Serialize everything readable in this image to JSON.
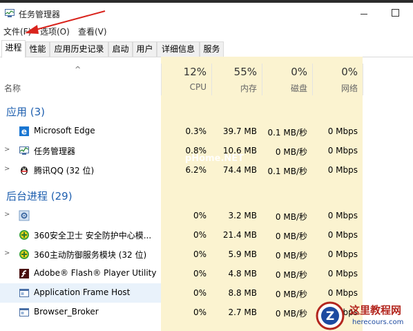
{
  "window": {
    "title": "任务管理器"
  },
  "menu": [
    {
      "label": "文件(F)"
    },
    {
      "label": "选项(O)"
    },
    {
      "label": "查看(V)"
    }
  ],
  "tabs": [
    {
      "label": "进程",
      "active": true
    },
    {
      "label": "性能"
    },
    {
      "label": "应用历史记录"
    },
    {
      "label": "启动"
    },
    {
      "label": "用户"
    },
    {
      "label": "详细信息"
    },
    {
      "label": "服务"
    }
  ],
  "columns": {
    "name_label": "名称",
    "cpu": {
      "percent": "12%",
      "label": "CPU"
    },
    "memory": {
      "percent": "55%",
      "label": "内存"
    },
    "disk": {
      "percent": "0%",
      "label": "磁盘"
    },
    "network": {
      "percent": "0%",
      "label": "网络"
    }
  },
  "groups": [
    {
      "title": "应用 (3)",
      "rows": [
        {
          "name": "Microsoft Edge",
          "icon": "edge-icon",
          "cpu": "0.3%",
          "memory": "39.7 MB",
          "disk": "0.1 MB/秒",
          "network": "0 Mbps",
          "expandable": false
        },
        {
          "name": "任务管理器",
          "icon": "task-manager-icon",
          "cpu": "0.8%",
          "memory": "10.6 MB",
          "disk": "0 MB/秒",
          "network": "0 Mbps",
          "expandable": true
        },
        {
          "name": "腾讯QQ (32 位)",
          "icon": "qq-penguin-icon",
          "cpu": "6.2%",
          "memory": "74.4 MB",
          "disk": "0.1 MB/秒",
          "network": "0 Mbps",
          "expandable": true
        }
      ]
    },
    {
      "title": "后台进程 (29)",
      "rows": [
        {
          "name": "",
          "icon": "gear-icon",
          "cpu": "0%",
          "memory": "3.2 MB",
          "disk": "0 MB/秒",
          "network": "0 Mbps",
          "expandable": true
        },
        {
          "name": "360安全卫士 安全防护中心模...",
          "icon": "360-shield-icon",
          "cpu": "0%",
          "memory": "21.4 MB",
          "disk": "0 MB/秒",
          "network": "0 Mbps",
          "expandable": false
        },
        {
          "name": "360主动防御服务模块 (32 位)",
          "icon": "360-shield-icon",
          "cpu": "0%",
          "memory": "5.9 MB",
          "disk": "0 MB/秒",
          "network": "0 Mbps",
          "expandable": true
        },
        {
          "name": "Adobe® Flash® Player Utility",
          "icon": "flash-icon",
          "cpu": "0%",
          "memory": "4.8 MB",
          "disk": "0 MB/秒",
          "network": "0 Mbps",
          "expandable": false
        },
        {
          "name": "Application Frame Host",
          "icon": "window-icon",
          "cpu": "0%",
          "memory": "8.8 MB",
          "disk": "0 MB/秒",
          "network": "0 Mbps",
          "expandable": false,
          "selected": true
        },
        {
          "name": "Browser_Broker",
          "icon": "window-icon",
          "cpu": "0%",
          "memory": "2.7 MB",
          "disk": "0 MB/秒",
          "network": "0 Mbps",
          "expandable": false
        }
      ]
    }
  ],
  "watermark": {
    "text": "pHome.NET"
  },
  "logo": {
    "title": "这里教程网",
    "subtitle": "herecours.com"
  },
  "colors": {
    "accent_blue": "#1e5faf",
    "column_highlight": "#fbf3d0",
    "selection": "#e9f2fb",
    "annotation_red": "#d9231c"
  }
}
